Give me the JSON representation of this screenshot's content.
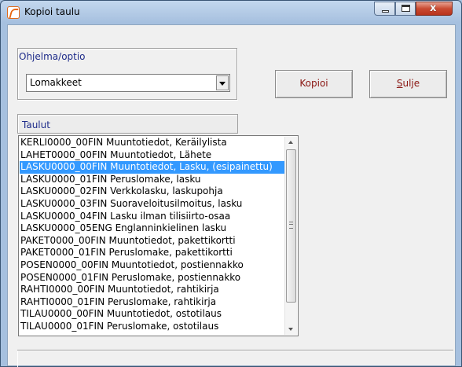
{
  "window": {
    "title": "Kopioi taulu",
    "controls": {
      "minimize_icon": "minimize-icon",
      "maximize_icon": "maximize-icon",
      "close_glyph": "x"
    }
  },
  "program_group": {
    "label": "Ohjelma/optio",
    "selected": "Lomakkeet"
  },
  "buttons": {
    "copy": "Kopioi",
    "close_first": "S",
    "close_rest": "ulje"
  },
  "tables": {
    "header": "Taulut",
    "selected_index": 2,
    "items": [
      "KERLI0000_00FIN Muuntotiedot, Keräilylista",
      "LAHET0000_00FIN Muuntotiedot, Lähete",
      "LASKU0000_00FIN Muuntotiedot, Lasku, (esipainettu)",
      "LASKU0000_01FIN Peruslomake, lasku",
      "LASKU0000_02FIN Verkkolasku, laskupohja",
      "LASKU0000_03FIN Suoraveloitusilmoitus, lasku",
      "LASKU0000_04FIN Lasku ilman tilisiirto-osaa",
      "LASKU0000_05ENG Englanninkielinen lasku",
      "PAKET0000_00FIN Muuntotiedot, pakettikortti",
      "PAKET0000_01FIN Peruslomake, pakettikortti",
      "POSEN0000_00FIN Muuntotiedot, postiennakko",
      "POSEN0000_01FIN Peruslomake, postiennakko",
      "RAHTI0000_00FIN Muuntotiedot, rahtikirja",
      "RAHTI0000_01FIN Peruslomake, rahtikirja",
      "TILAU0000_00FIN Muuntotiedot, ostotilaus",
      "TILAU0000_01FIN Peruslomake, ostotilaus"
    ]
  }
}
